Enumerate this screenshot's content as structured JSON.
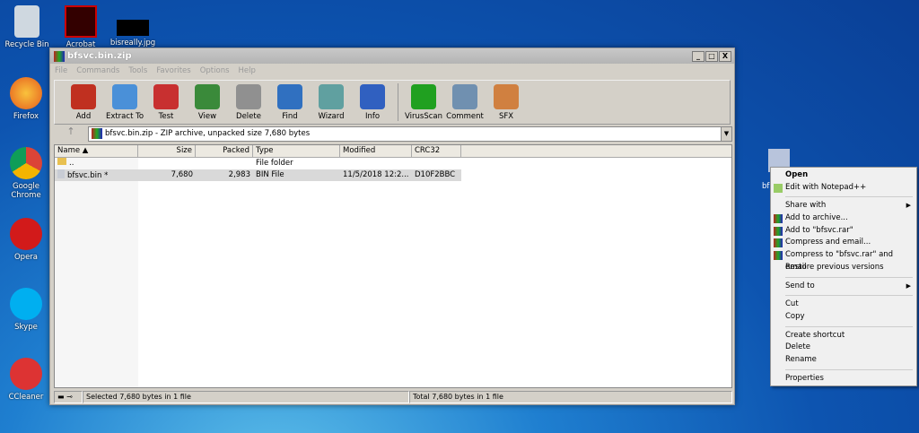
{
  "desktop": {
    "icons": [
      {
        "label": "Recycle Bin"
      },
      {
        "label": "Acrobat"
      },
      {
        "label": "bisreally.jpg"
      },
      {
        "label": "Firefox"
      },
      {
        "label": "Google Chrome"
      },
      {
        "label": "Opera"
      },
      {
        "label": "Skype"
      },
      {
        "label": "CCleaner"
      }
    ],
    "file_icon_label": "bf"
  },
  "window": {
    "title": "bfsvc.bin.zip",
    "controls": [
      "_",
      "□",
      "X"
    ],
    "menu": [
      "File",
      "Commands",
      "Tools",
      "Favorites",
      "Options",
      "Help"
    ],
    "toolbar": [
      {
        "label": "Add",
        "color": "#c03020"
      },
      {
        "label": "Extract To",
        "color": "#4a90d8"
      },
      {
        "label": "Test",
        "color": "#c83030"
      },
      {
        "label": "View",
        "color": "#3a8a3a"
      },
      {
        "label": "Delete",
        "color": "#909090"
      },
      {
        "label": "Find",
        "color": "#3070c0"
      },
      {
        "label": "Wizard",
        "color": "#60a0a0"
      },
      {
        "label": "Info",
        "color": "#3060c0"
      },
      {
        "label": "VirusScan",
        "color": "#20a020"
      },
      {
        "label": "Comment",
        "color": "#7090b0"
      },
      {
        "label": "SFX",
        "color": "#d08040"
      }
    ],
    "address": "bfsvc.bin.zip - ZIP archive, unpacked size 7,680 bytes",
    "columns": [
      "Name ▲",
      "Size",
      "Packed",
      "Type",
      "Modified",
      "CRC32"
    ],
    "rows": [
      {
        "name": "..",
        "size": "",
        "packed": "",
        "type": "File folder",
        "modified": "",
        "crc": ""
      },
      {
        "name": "bfsvc.bin *",
        "size": "7,680",
        "packed": "2,983",
        "type": "BIN File",
        "modified": "11/5/2018 12:2...",
        "crc": "D10F2BBC"
      }
    ],
    "status_left": "Selected 7,680 bytes in 1 file",
    "status_right": "Total 7,680 bytes in 1 file"
  },
  "context_menu": {
    "items": [
      "Open",
      "Edit with Notepad++",
      "Share with",
      "Add to archive...",
      "Add to \"bfsvc.rar\"",
      "Compress and email...",
      "Compress to \"bfsvc.rar\" and email",
      "Restore previous versions",
      "Send to",
      "Cut",
      "Copy",
      "Create shortcut",
      "Delete",
      "Rename",
      "Properties"
    ]
  }
}
